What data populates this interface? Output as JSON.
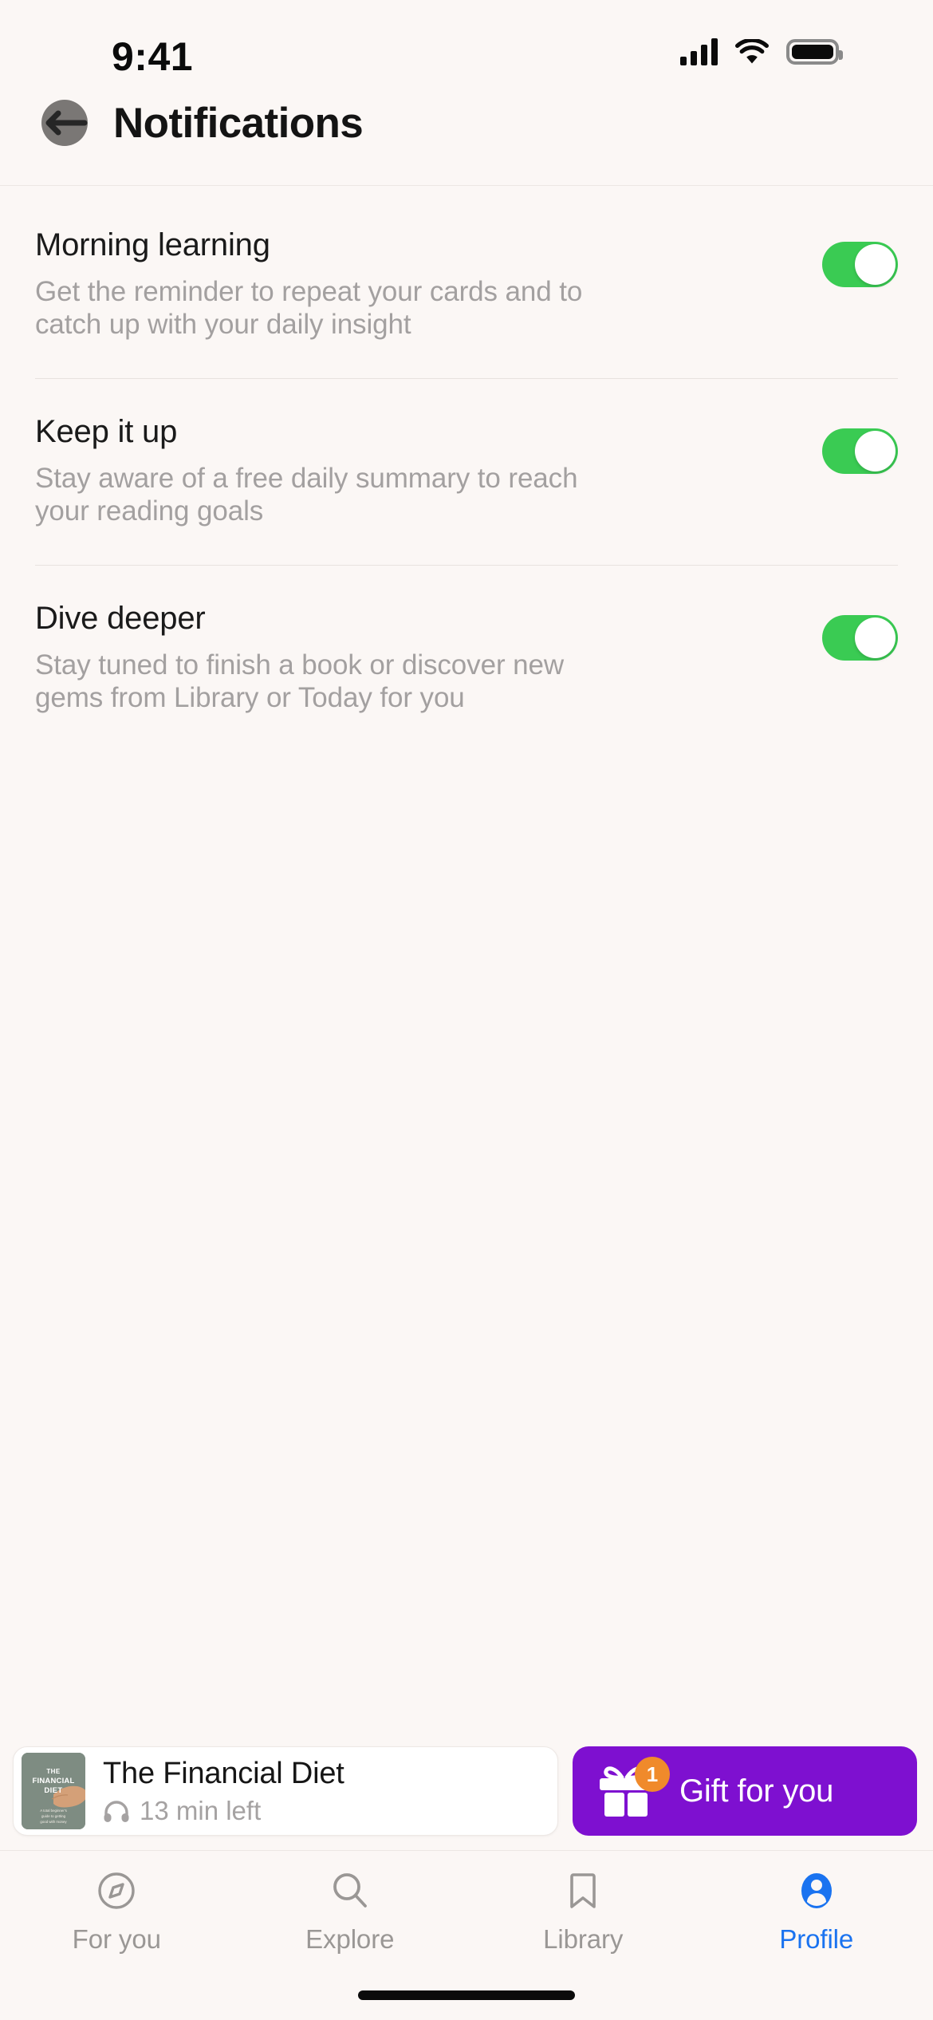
{
  "status_bar": {
    "time": "9:41",
    "cellular_icon": "signal-bars-icon",
    "wifi_icon": "wifi-icon",
    "battery_icon": "battery-full-icon"
  },
  "header": {
    "back_icon": "back-arrow-icon",
    "title": "Notifications"
  },
  "settings": {
    "items": [
      {
        "title": "Morning learning",
        "description": "Get the reminder to repeat your cards and to catch up with your daily insight",
        "toggle_state": "on"
      },
      {
        "title": "Keep it up",
        "description": "Stay aware of a free daily summary to reach your reading goals",
        "toggle_state": "on"
      },
      {
        "title": "Dive deeper",
        "description": "Stay tuned to finish a book or discover new gems from Library or Today for you",
        "toggle_state": "on"
      }
    ]
  },
  "player": {
    "cover_line1": "THE",
    "cover_line2": "FINANCIAL",
    "cover_line3": "DIET",
    "cover_subtitle": "A total beginner's guide to getting good with money",
    "title": "The Financial Diet",
    "headphones_icon": "headphones-icon",
    "time_left": "13 min left"
  },
  "gift": {
    "icon": "gift-box-icon",
    "badge_count": "1",
    "label": "Gift for you"
  },
  "tabbar": {
    "items": [
      {
        "label": "For you",
        "icon": "compass-icon",
        "active": false
      },
      {
        "label": "Explore",
        "icon": "search-icon",
        "active": false
      },
      {
        "label": "Library",
        "icon": "bookmark-icon",
        "active": false
      },
      {
        "label": "Profile",
        "icon": "person-icon",
        "active": true
      }
    ]
  },
  "colors": {
    "background": "#FBF7F5",
    "toggle_on": "#3ACB53",
    "gift_purple": "#7E10D0",
    "badge_orange": "#F08A2B",
    "active_tab_blue": "#1A73F0",
    "cover_green": "#7E8C82"
  }
}
